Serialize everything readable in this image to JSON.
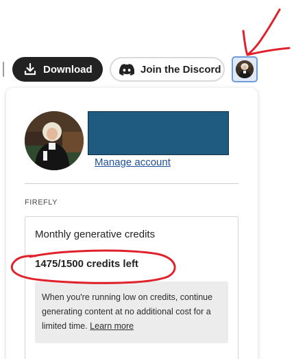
{
  "toolbar": {
    "download_label": "Download",
    "discord_label": "Join the Discord"
  },
  "account": {
    "manage_label": "Manage account"
  },
  "firefly": {
    "section_label": "FIREFLY",
    "card_title": "Monthly generative credits",
    "credits_left": "1475/1500 credits left",
    "info_text": "When you're running low on credits, continue generating content at no additional cost for a limited time.",
    "learn_more": "Learn more"
  },
  "colors": {
    "download_bg": "#222222",
    "redaction": "#1f5b80",
    "link": "#1f4f9c",
    "annotation": "#e0202a",
    "avatar_selected_border": "#6f9bd8"
  },
  "icons": {
    "download": "download-icon",
    "discord": "discord-icon"
  }
}
